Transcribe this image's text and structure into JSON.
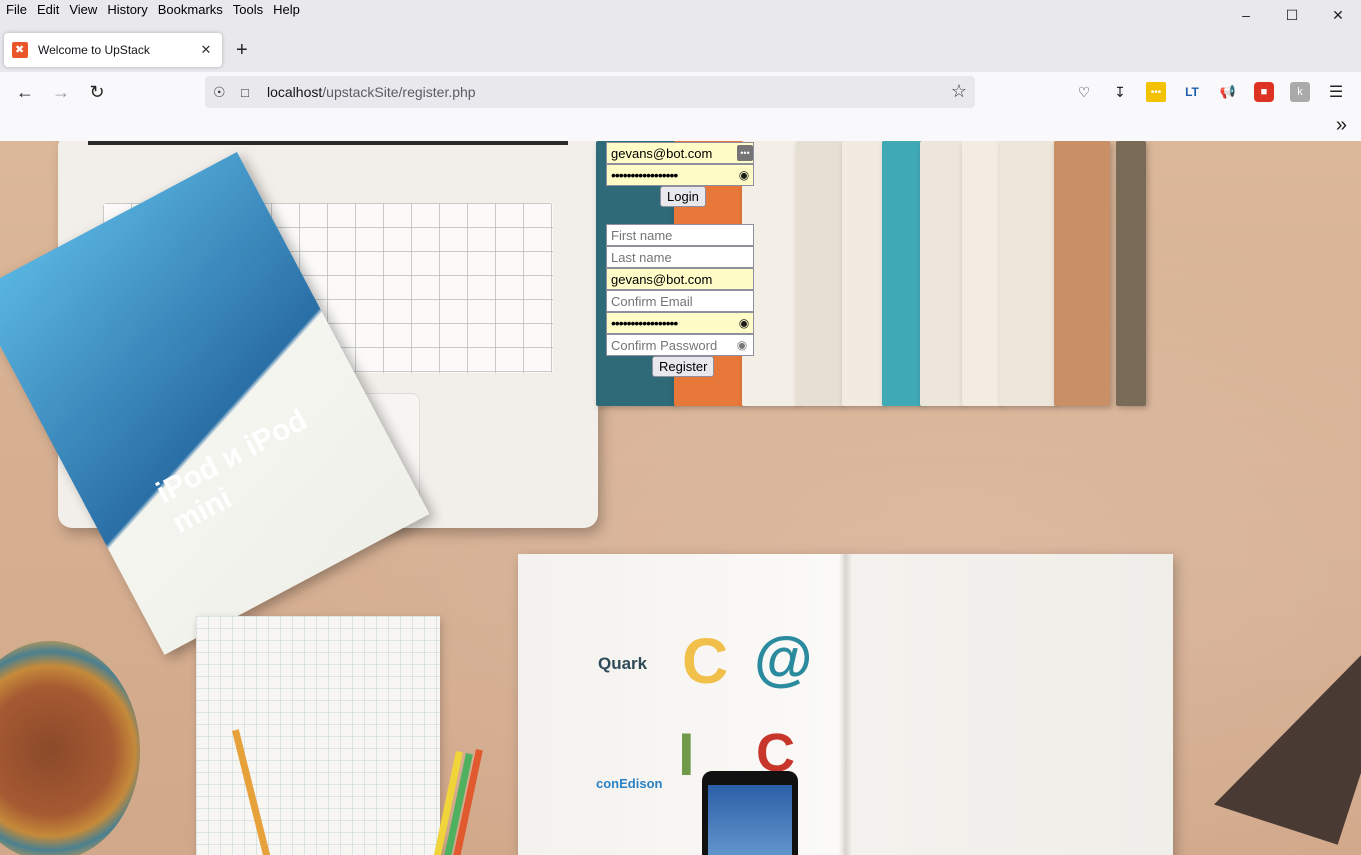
{
  "menubar": {
    "items": [
      "File",
      "Edit",
      "View",
      "History",
      "Bookmarks",
      "Tools",
      "Help"
    ]
  },
  "window_controls": {
    "minimize_icon": "minimize-icon",
    "maximize_icon": "maximize-icon",
    "close_icon": "close-icon"
  },
  "tab": {
    "title": "Welcome to UpStack",
    "favicon": "xampp-favicon-icon"
  },
  "navbar": {
    "url_host": "localhost",
    "url_path": "/upstackSite/register.php"
  },
  "login_form": {
    "email_value": "gevans@bot.com",
    "password_value": "•••••••••••••••••",
    "login_label": "Login"
  },
  "register_form": {
    "first_name_placeholder": "First name",
    "last_name_placeholder": "Last name",
    "email_value": "gevans@bot.com",
    "confirm_email_placeholder": "Confirm Email",
    "password_value": "•••••••••••••••••",
    "confirm_password_placeholder": "Confirm Password",
    "register_label": "Register"
  },
  "background": {
    "ipod_book_text": "iPod и iPod mini",
    "logos": [
      "Quark",
      "conEdison"
    ]
  },
  "colors": {
    "autofill": "#fffcc8",
    "chrome": "#e9e9ed",
    "toolbar": "#f9f9fb"
  }
}
